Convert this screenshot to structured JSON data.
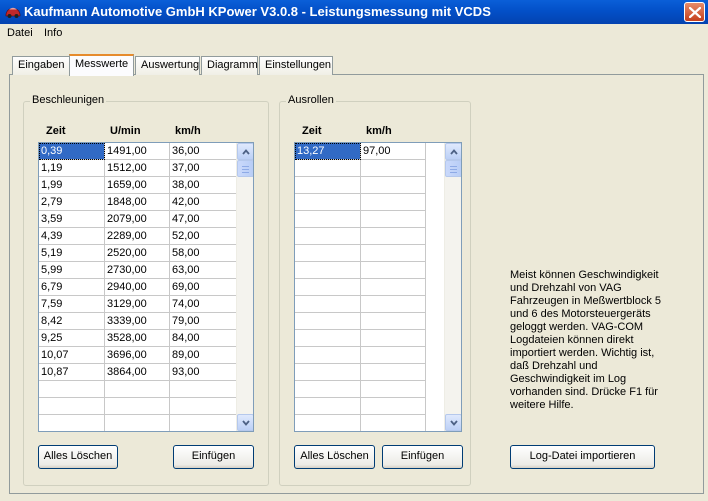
{
  "window": {
    "title": "Kaufmann Automotive GmbH  KPower V3.0.8 - Leistungsmessung mit VCDS"
  },
  "menu": [
    "Datei",
    "Info"
  ],
  "tabs": [
    "Eingaben",
    "Messwerte",
    "Auswertung",
    "Diagramm",
    "Einstellungen"
  ],
  "active_tab": "Messwerte",
  "acceleration": {
    "label": "Beschleunigen",
    "headers": [
      "Zeit",
      "U/min",
      "km/h"
    ],
    "rows": [
      [
        "0,39",
        "1491,00",
        "36,00"
      ],
      [
        "1,19",
        "1512,00",
        "37,00"
      ],
      [
        "1,99",
        "1659,00",
        "38,00"
      ],
      [
        "2,79",
        "1848,00",
        "42,00"
      ],
      [
        "3,59",
        "2079,00",
        "47,00"
      ],
      [
        "4,39",
        "2289,00",
        "52,00"
      ],
      [
        "5,19",
        "2520,00",
        "58,00"
      ],
      [
        "5,99",
        "2730,00",
        "63,00"
      ],
      [
        "6,79",
        "2940,00",
        "69,00"
      ],
      [
        "7,59",
        "3129,00",
        "74,00"
      ],
      [
        "8,42",
        "3339,00",
        "79,00"
      ],
      [
        "9,25",
        "3528,00",
        "84,00"
      ],
      [
        "10,07",
        "3696,00",
        "89,00"
      ],
      [
        "10,87",
        "3864,00",
        "93,00"
      ]
    ],
    "clear_label": "Alles Löschen",
    "insert_label": "Einfügen"
  },
  "rolling": {
    "label": "Ausrollen",
    "headers": [
      "Zeit",
      "km/h"
    ],
    "rows": [
      [
        "13,27",
        "97,00"
      ]
    ],
    "clear_label": "Alles Löschen",
    "insert_label": "Einfügen"
  },
  "info_text": "Meist können Geschwindigkeit und Drehzahl von VAG Fahrzeugen in Meßwertblock 5 und 6 des Motorsteuergeräts geloggt werden. VAG-COM Logdateien können direkt importiert werden. Wichtig ist, daß Drehzahl und Geschwindigkeit im Log vorhanden sind. Drücke F1 für weitere Hilfe.",
  "import_label": "Log-Datei importieren"
}
